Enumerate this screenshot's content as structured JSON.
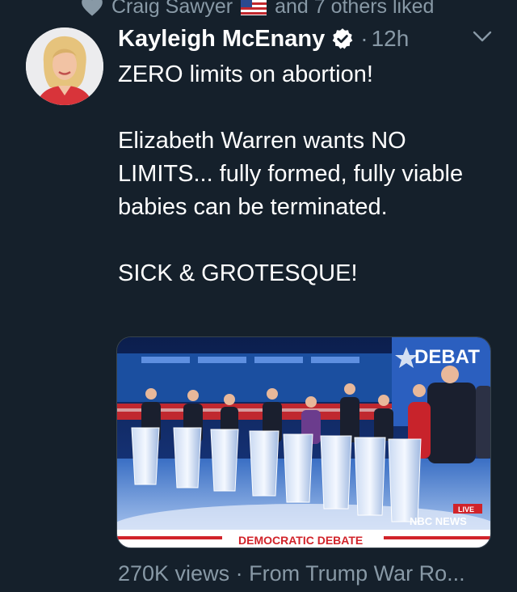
{
  "social_context": {
    "name": "Craig Sawyer",
    "suffix": "and 7 others liked"
  },
  "tweet": {
    "author": "Kayleigh McEnany",
    "separator": "·",
    "time": "12h",
    "text_lines": [
      "ZERO limits on abortion!",
      "",
      "Elizabeth Warren wants NO LIMITS... fully formed, fully viable babies can be terminated.",
      "",
      "SICK & GROTESQUE!"
    ]
  },
  "media": {
    "stage_sign": "DEBAT",
    "live_badge": "LIVE",
    "network": "NBC NEWS",
    "banner": "DEMOCRATIC DEBATE"
  },
  "footer": {
    "views": "270K views",
    "separator": "·",
    "source": "From Trump War Ro..."
  },
  "colors": {
    "background": "#15202b",
    "secondary_text": "#8899a6",
    "stage_blue": "#1b4fa0",
    "banner_red": "#d1232a"
  }
}
